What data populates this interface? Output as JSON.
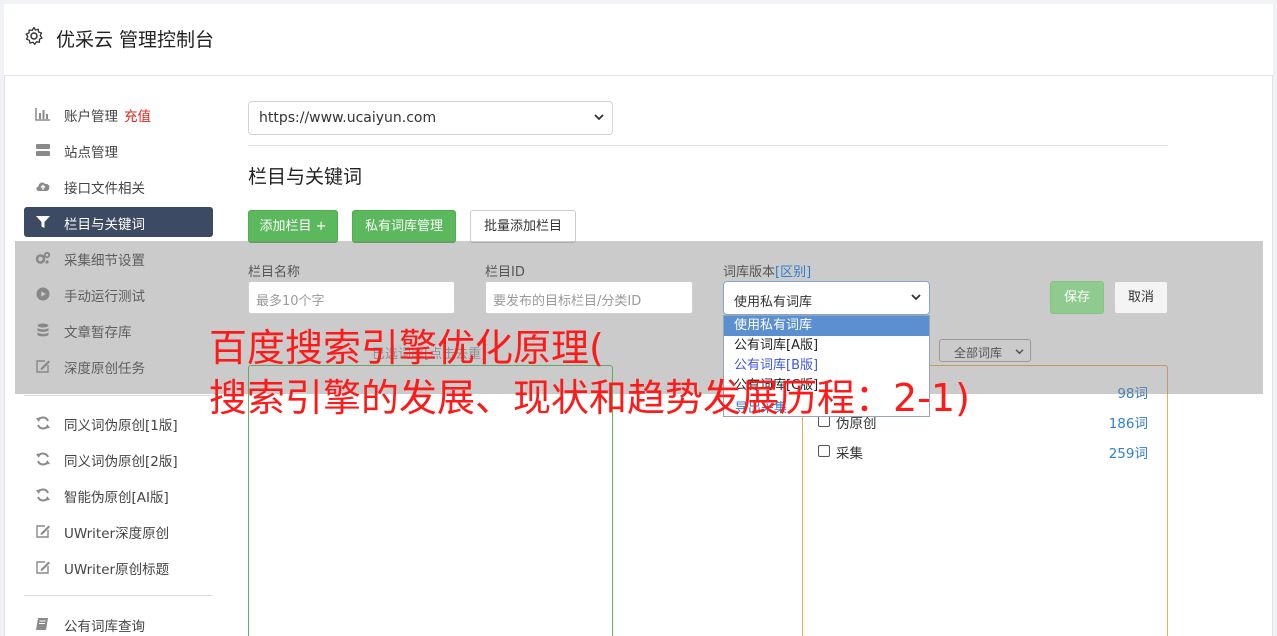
{
  "app": {
    "title": "优采云 管理控制台"
  },
  "sidebar": {
    "items": [
      {
        "label": "账户管理",
        "tag": "充值",
        "icon": "bar-chart-icon"
      },
      {
        "label": "站点管理",
        "icon": "server-icon"
      },
      {
        "label": "接口文件相关",
        "icon": "cloud-upload-icon"
      },
      {
        "label": "栏目与关键词",
        "icon": "filter-icon",
        "active": true
      },
      {
        "label": "采集细节设置",
        "icon": "cogs-icon"
      },
      {
        "label": "手动运行测试",
        "icon": "play-circle-icon"
      },
      {
        "label": "文章暂存库",
        "icon": "database-icon"
      },
      {
        "label": "深度原创任务",
        "icon": "edit-icon"
      },
      {
        "label": "同义词伪原创[1版]",
        "icon": "refresh-icon"
      },
      {
        "label": "同义词伪原创[2版]",
        "icon": "refresh-icon"
      },
      {
        "label": "智能伪原创[AI版]",
        "icon": "refresh-icon"
      },
      {
        "label": "UWriter深度原创",
        "icon": "edit-icon"
      },
      {
        "label": "UWriter原创标题",
        "icon": "edit-icon"
      },
      {
        "label": "公有词库查询",
        "icon": "book-icon"
      }
    ]
  },
  "site_select": {
    "value": "https://www.ucaiyun.com"
  },
  "section": {
    "title": "栏目与关键词"
  },
  "toolbar": {
    "add_column": "添加栏目 +",
    "private_lib": "私有词库管理",
    "batch_add": "批量添加栏目"
  },
  "form": {
    "name_label": "栏目名称",
    "name_placeholder": "最多10个字",
    "id_label": "栏目ID",
    "id_placeholder": "要发布的目标栏目/分类ID",
    "lib_label": "词库版本",
    "lib_label_link": "[区别]",
    "lib_value": "使用私有词库",
    "save": "保存",
    "cancel": "取消"
  },
  "lib_dropdown": {
    "options": [
      "使用私有词库",
      "公有词库[A版]",
      "公有词库[B版]",
      "公有词库[C版]"
    ],
    "link": "导出采集"
  },
  "keywords": {
    "hint": "已选词库[点击去重]",
    "filter_value": "全部词库",
    "libs": [
      {
        "name": "",
        "count": "98词"
      },
      {
        "name": "伪原创",
        "count": "186词"
      },
      {
        "name": "采集",
        "count": "259词"
      }
    ]
  },
  "banner": {
    "line1": "百度搜索引擎优化原理(",
    "line2": "搜索引擎的发展、现状和趋势发展历程：2-1)"
  }
}
